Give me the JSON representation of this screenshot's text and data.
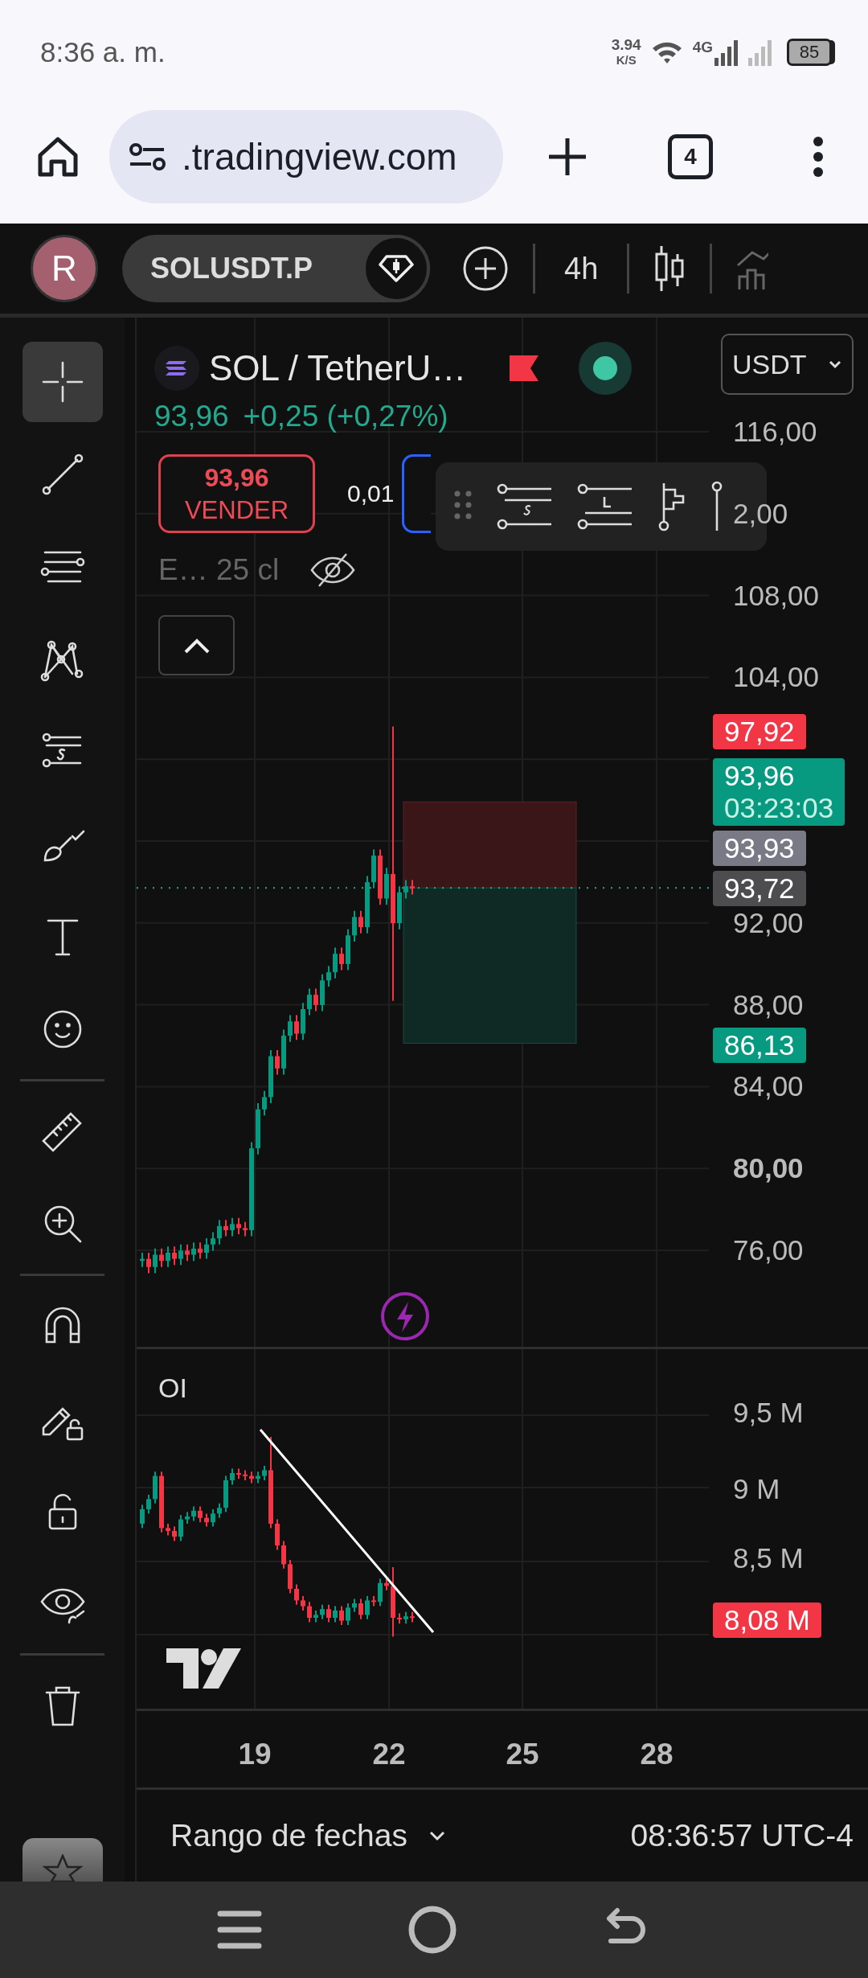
{
  "status_bar": {
    "time": "8:36 a. m.",
    "net_speed": "3.94",
    "net_unit": "K/S",
    "network": "4G",
    "battery": "85"
  },
  "browser": {
    "url": ".tradingview.com",
    "tab_count": "4"
  },
  "top_toolbar": {
    "avatar": "R",
    "symbol": "SOLUSDT.P",
    "interval": "4h"
  },
  "drawing_tools": {
    "groups": [
      {
        "tools": [
          {
            "kind": "crosshair",
            "selected": true
          },
          {
            "kind": "trend-line",
            "selected": false
          },
          {
            "kind": "parallel-lines",
            "selected": false
          },
          {
            "kind": "pattern",
            "selected": false
          },
          {
            "kind": "position",
            "selected": false
          },
          {
            "kind": "brush",
            "selected": false
          },
          {
            "kind": "text",
            "selected": false
          },
          {
            "kind": "emoji",
            "selected": false
          }
        ]
      },
      {
        "tools": [
          {
            "kind": "ruler",
            "selected": false
          },
          {
            "kind": "zoom",
            "selected": false
          }
        ]
      },
      {
        "tools": [
          {
            "kind": "magnet",
            "selected": false
          },
          {
            "kind": "lock-drawings",
            "selected": false
          },
          {
            "kind": "lock",
            "selected": false
          },
          {
            "kind": "hide",
            "selected": false
          }
        ]
      },
      {
        "tools": [
          {
            "kind": "trash",
            "selected": false
          }
        ]
      }
    ]
  },
  "chart": {
    "title": "SOL / TetherU…",
    "last_price": "93,96",
    "change": "+0,25 (+0,27%)",
    "currency": "USDT",
    "sell_button": {
      "price": "93,96",
      "label": "VENDER"
    },
    "quantity": "0,01",
    "indicator_label": "E… 25 cl",
    "price_axis": [
      {
        "label": "116,00",
        "bold": false
      },
      {
        "label": "2,00",
        "bold": false
      },
      {
        "label": "108,00",
        "bold": false
      },
      {
        "label": "104,00",
        "bold": false
      },
      {
        "label": "92,00",
        "bold": false
      },
      {
        "label": "88,00",
        "bold": false
      },
      {
        "label": "84,00",
        "bold": false
      },
      {
        "label": "80,00",
        "bold": true
      },
      {
        "label": "76,00",
        "bold": false
      }
    ],
    "price_badges": [
      {
        "label": "97,92",
        "color": "#f23645"
      },
      {
        "label": "93,96",
        "countdown": "03:23:03",
        "color": "#089981"
      },
      {
        "label": "93,93",
        "color": "#787b86"
      },
      {
        "label": "93,72",
        "color": "#4d4d4f"
      },
      {
        "label": "86,13",
        "color": "#089981"
      }
    ],
    "oi_pane": {
      "label": "OI",
      "axis": [
        "9,5 M",
        "9 M",
        "8,5 M"
      ],
      "badge": "8,08 M"
    },
    "time_axis": [
      "19",
      "22",
      "25",
      "28"
    ]
  },
  "bottom_bar": {
    "date_range": "Rango de fechas",
    "clock": "08:36:57 UTC-4"
  }
}
